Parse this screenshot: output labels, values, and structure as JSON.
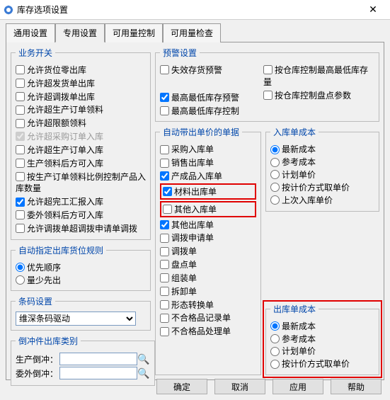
{
  "title": "库存选项设置",
  "tabs": [
    "通用设置",
    "专用设置",
    "可用量控制",
    "可用量检查"
  ],
  "active_tab": "专用设置",
  "business_switch": {
    "legend": "业务开关",
    "items": [
      {
        "label": "允许货位零出库",
        "checked": false,
        "disabled": false
      },
      {
        "label": "允许超发货单出库",
        "checked": false,
        "disabled": false
      },
      {
        "label": "允许超调拨单出库",
        "checked": false,
        "disabled": false
      },
      {
        "label": "允许超生产订单领料",
        "checked": false,
        "disabled": false
      },
      {
        "label": "允许超限额领料",
        "checked": false,
        "disabled": false
      },
      {
        "label": "允许超采购订单入库",
        "checked": true,
        "disabled": true
      },
      {
        "label": "允许超生产订单入库",
        "checked": false,
        "disabled": false
      },
      {
        "label": "生产领料后方可入库",
        "checked": false,
        "disabled": false
      },
      {
        "label": "按生产订单领料比例控制产品入库数量",
        "checked": false,
        "disabled": false
      },
      {
        "label": "允许超完工汇报入库",
        "checked": true,
        "disabled": false
      },
      {
        "label": "委外领料后方可入库",
        "checked": false,
        "disabled": false
      },
      {
        "label": "允许调拨单超调拨申请单调拨",
        "checked": false,
        "disabled": false
      }
    ]
  },
  "auto_loc_rule": {
    "legend": "自动指定出库货位规则",
    "options": [
      "优先顺序",
      "量少先出"
    ],
    "selected": "优先顺序"
  },
  "barcode": {
    "legend": "条码设置",
    "value": "维深条码驱动"
  },
  "reverse": {
    "legend": "倒冲件出库类别",
    "fields": [
      {
        "label": "生产倒冲：",
        "value": ""
      },
      {
        "label": "委外倒冲：",
        "value": ""
      }
    ]
  },
  "alert": {
    "legend": "预警设置",
    "left": [
      {
        "label": "失效存货预警",
        "checked": false
      },
      {
        "label": "最高最低库存预警",
        "checked": true
      },
      {
        "label": "最高最低库存控制",
        "checked": false
      }
    ],
    "right": [
      {
        "label": "按仓库控制最高最低库存量",
        "checked": false
      },
      {
        "label": "按仓库控制盘点参数",
        "checked": false
      }
    ]
  },
  "auto_price": {
    "legend": "自动带出单价的单据",
    "items": [
      {
        "label": "采购入库单",
        "checked": false
      },
      {
        "label": "销售出库单",
        "checked": false
      },
      {
        "label": "产成品入库单",
        "checked": true,
        "hl": false
      },
      {
        "label": "材料出库单",
        "checked": true,
        "hl": true
      },
      {
        "label": "其他入库单",
        "checked": false,
        "hl": true
      },
      {
        "label": "其他出库单",
        "checked": true
      },
      {
        "label": "调拨申请单",
        "checked": false
      },
      {
        "label": "调拨单",
        "checked": false
      },
      {
        "label": "盘点单",
        "checked": false
      },
      {
        "label": "组装单",
        "checked": false
      },
      {
        "label": "拆卸单",
        "checked": false
      },
      {
        "label": "形态转换单",
        "checked": false
      },
      {
        "label": "不合格品记录单",
        "checked": false
      },
      {
        "label": "不合格品处理单",
        "checked": false
      }
    ]
  },
  "in_cost": {
    "legend": "入库单成本",
    "options": [
      "最新成本",
      "参考成本",
      "计划单价",
      "按计价方式取单价",
      "上次入库单价"
    ],
    "selected": "最新成本"
  },
  "out_cost": {
    "legend": "出库单成本",
    "options": [
      "最新成本",
      "参考成本",
      "计划单价",
      "按计价方式取单价"
    ],
    "selected": "最新成本"
  },
  "buttons": {
    "ok": "确定",
    "cancel": "取消",
    "apply": "应用",
    "help": "帮助"
  }
}
